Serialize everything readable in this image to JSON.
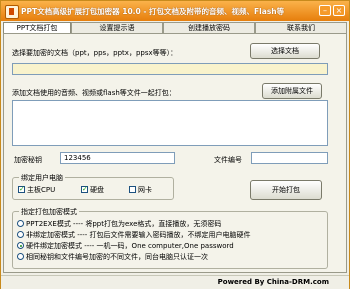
{
  "window": {
    "title": "PPT文档高级扩展打包加密器 10.0 - 打包文档及附带的音频、视频、Flash等",
    "minimize_icon": "minimize-icon",
    "close_icon": "close-icon",
    "accent_color": "#f39a2a"
  },
  "tabs": [
    {
      "label": "PPT文档打包"
    },
    {
      "label": "设置提示语"
    },
    {
      "label": "创建播放密码"
    },
    {
      "label": "联系我们"
    }
  ],
  "main": {
    "select_doc_label": "选择要加密的文档（ppt，pps，pptx，ppsx等等）：",
    "select_doc_button": "选择文档",
    "doc_path_value": "",
    "attach_label": "添加文档使用的音频、视频或flash等文件一起打包：",
    "attach_button": "添加附属文件",
    "password_label": "加密秘钥",
    "password_value": "123456",
    "doc_number_label": "文件编号",
    "doc_number_value": ""
  },
  "bind_group": {
    "title": "绑定用户电脑",
    "options": [
      {
        "label": "主板CPU",
        "checked": true
      },
      {
        "label": "硬盘",
        "checked": true
      },
      {
        "label": "网卡",
        "checked": false
      }
    ],
    "start_button": "开始打包"
  },
  "mode_group": {
    "title": "指定打包加密模式",
    "options": [
      {
        "label": "PPT2EXE模式 ---- 将ppt打包为exe格式，直接播放，无须密码",
        "selected": false
      },
      {
        "label": "非绑定加密模式 ---- 打包后文件需要输入密码播放，不绑定用户电脑硬件",
        "selected": false
      },
      {
        "label": "硬件绑定加密模式 ---- 一机一码，One computer,One password",
        "selected": true
      },
      {
        "label": "相同秘钥和文件编号加密的不同文件，同台电脑只认证一次",
        "selected": false
      }
    ]
  },
  "footer": {
    "text": "Powered By China-DRM.com"
  }
}
